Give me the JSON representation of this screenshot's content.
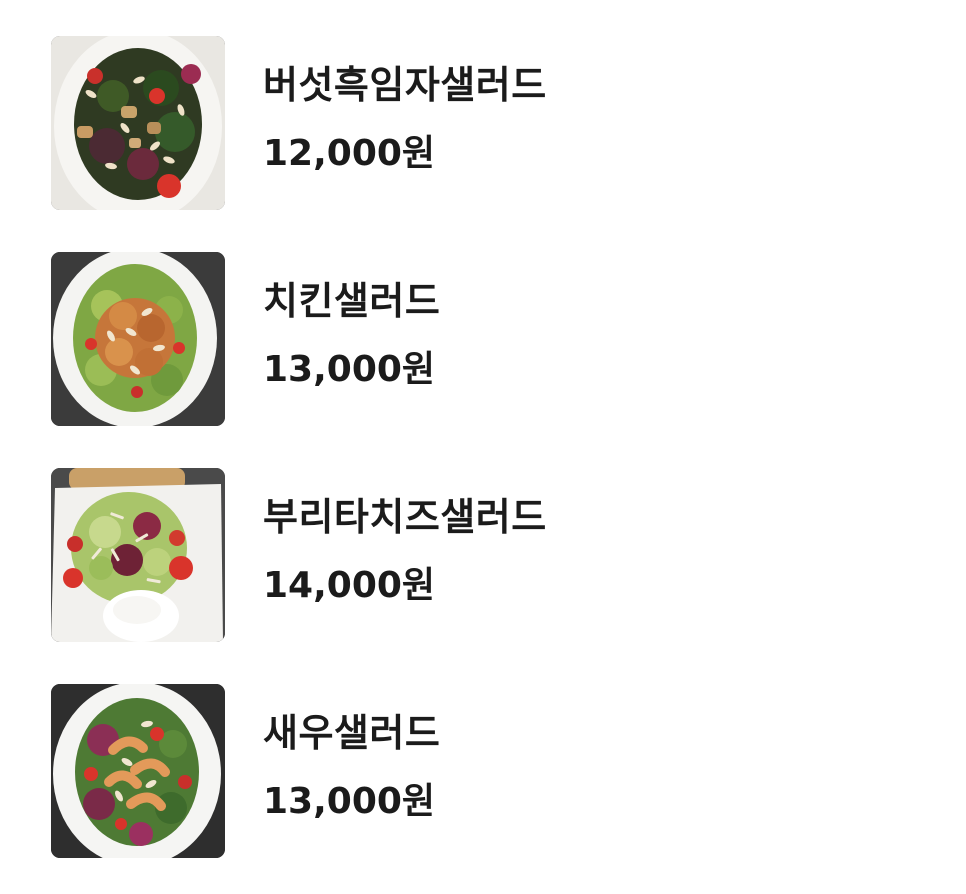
{
  "menu": {
    "items": [
      {
        "name": "버섯흑임자샐러드",
        "price": "12,000원",
        "image": "mushroom-black-sesame-salad-photo"
      },
      {
        "name": "치킨샐러드",
        "price": "13,000원",
        "image": "chicken-salad-photo"
      },
      {
        "name": "부리타치즈샐러드",
        "price": "14,000원",
        "image": "burrata-cheese-salad-photo"
      },
      {
        "name": "새우샐러드",
        "price": "13,000원",
        "image": "shrimp-salad-photo"
      }
    ]
  }
}
